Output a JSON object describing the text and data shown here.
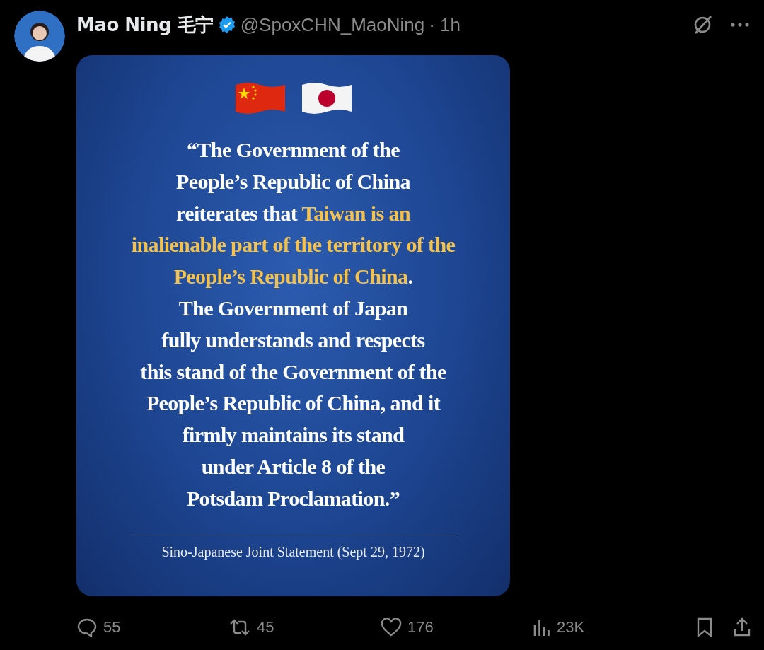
{
  "post": {
    "author": "Mao Ning 毛宁",
    "verified": true,
    "handle": "@SpoxCHN_MaoNing",
    "time": "· 1h"
  },
  "poster": {
    "quote": [
      [
        {
          "text": "“The Government of the",
          "highlight": false
        }
      ],
      [
        {
          "text": "People’s Republic of China",
          "highlight": false
        }
      ],
      [
        {
          "text": "reiterates that ",
          "highlight": false
        },
        {
          "text": "Taiwan is an",
          "highlight": true
        }
      ],
      [
        {
          "text": "inalienable part of the territory of the",
          "highlight": true
        }
      ],
      [
        {
          "text": "People’s Republic of China",
          "highlight": true
        },
        {
          "text": ".",
          "highlight": false
        }
      ],
      [
        {
          "text": "The Government of Japan",
          "highlight": false
        }
      ],
      [
        {
          "text": "fully understands and respects",
          "highlight": false
        }
      ],
      [
        {
          "text": "this stand of the Government of the",
          "highlight": false
        }
      ],
      [
        {
          "text": "People’s Republic of China, and it",
          "highlight": false
        }
      ],
      [
        {
          "text": "firmly maintains its stand",
          "highlight": false
        }
      ],
      [
        {
          "text": "under Article 8 of the",
          "highlight": false
        }
      ],
      [
        {
          "text": "Potsdam Proclamation.”",
          "highlight": false
        }
      ]
    ],
    "source": "Sino-Japanese Joint Statement (Sept 29, 1972)"
  },
  "actions": [
    {
      "kind": "reply",
      "count": "55"
    },
    {
      "kind": "repost",
      "count": "45"
    },
    {
      "kind": "like",
      "count": "176"
    },
    {
      "kind": "views",
      "count": "23K"
    }
  ]
}
